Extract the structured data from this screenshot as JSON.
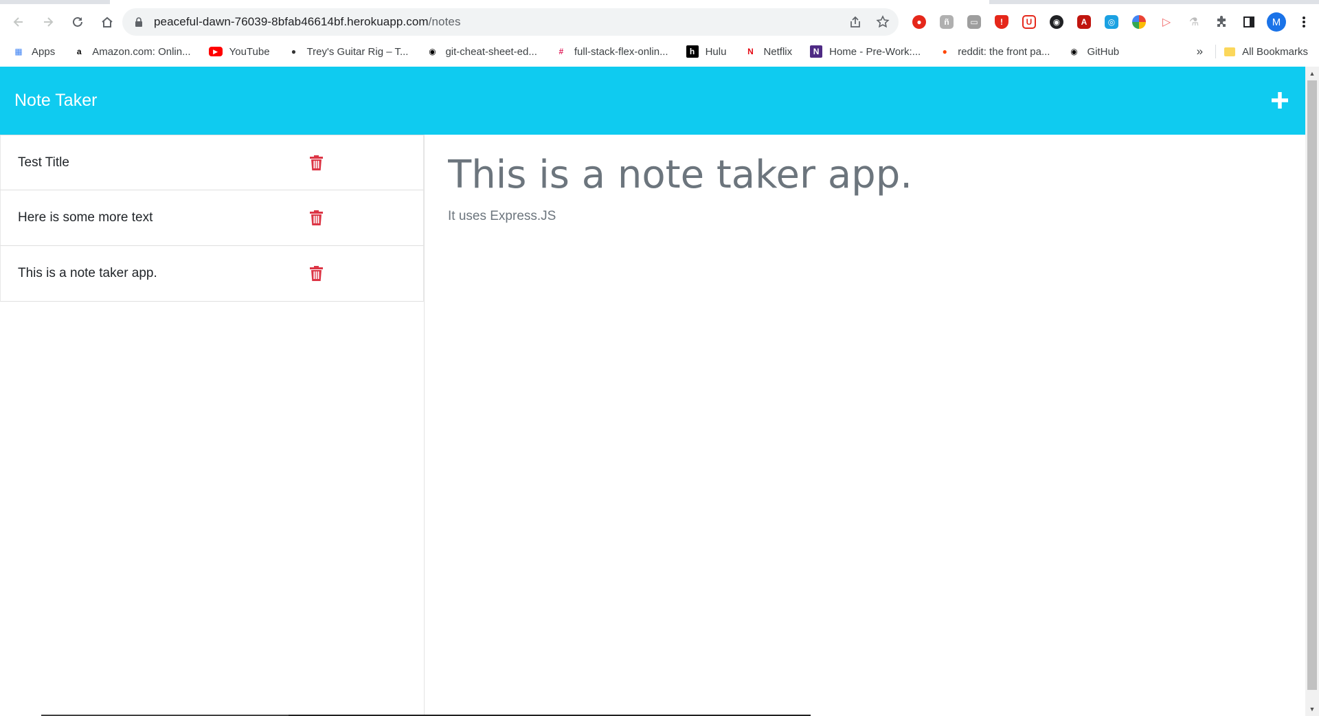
{
  "browser": {
    "url_host": "peaceful-dawn-76039-8bfab46614bf.herokuapp.com",
    "url_path": "/notes",
    "profile_initial": "M",
    "bookmarks": [
      {
        "label": "Apps",
        "icon": "apps-grid-icon",
        "color": "#4285f4"
      },
      {
        "label": "Amazon.com: Onlin...",
        "icon": "amazon-icon",
        "color": "#000000"
      },
      {
        "label": "YouTube",
        "icon": "youtube-icon",
        "color": "#ff0000"
      },
      {
        "label": "Trey's Guitar Rig – T...",
        "icon": "profile-photo-icon",
        "color": "#333333"
      },
      {
        "label": "git-cheat-sheet-ed...",
        "icon": "github-icon",
        "color": "#000000"
      },
      {
        "label": "full-stack-flex-onlin...",
        "icon": "slack-icon",
        "color": "#e01e5a"
      },
      {
        "label": "Hulu",
        "icon": "hulu-icon",
        "color": "#000000"
      },
      {
        "label": "Netflix",
        "icon": "netflix-icon",
        "color": "#e50914"
      },
      {
        "label": "Home - Pre-Work:...",
        "icon": "northwestern-icon",
        "color": "#4e2a84"
      },
      {
        "label": "reddit: the front pa...",
        "icon": "reddit-icon",
        "color": "#ff4500"
      },
      {
        "label": "GitHub",
        "icon": "github-icon",
        "color": "#000000"
      }
    ],
    "all_bookmarks_label": "All Bookmarks",
    "overflow_label": "»"
  },
  "app": {
    "brand": "Note Taker",
    "accent_color": "#0fcbf0",
    "delete_color": "#dc3545",
    "notes": [
      {
        "title": "Test Title"
      },
      {
        "title": "Here is some more text"
      },
      {
        "title": "This is a note taker app."
      }
    ],
    "active_note": {
      "title": "This is a note taker app.",
      "text": "It uses Express.JS"
    }
  }
}
